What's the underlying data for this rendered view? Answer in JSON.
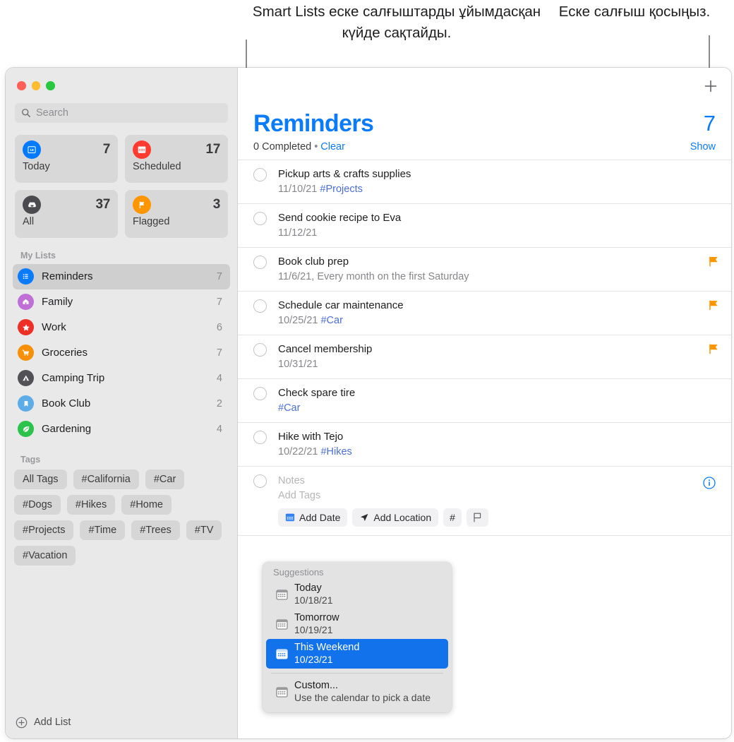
{
  "callouts": {
    "smart_lists": "Smart Lists еске салғыштарды ұйымдасқан күйде сақтайды.",
    "add_reminder": "Еске салғыш қосыңыз."
  },
  "sidebar": {
    "search": {
      "placeholder": "Search",
      "icon": "search-icon"
    },
    "smart_lists": [
      {
        "label": "Today",
        "count": "7",
        "icon": "calendar-day-icon",
        "color": "#007aff"
      },
      {
        "label": "Scheduled",
        "count": "17",
        "icon": "calendar-icon",
        "color": "#ff3b30"
      },
      {
        "label": "All",
        "count": "37",
        "icon": "tray-icon",
        "color": "#4a4a4f"
      },
      {
        "label": "Flagged",
        "count": "3",
        "icon": "flag-icon",
        "color": "#ff9500"
      }
    ],
    "my_lists_title": "My Lists",
    "my_lists": [
      {
        "label": "Reminders",
        "count": "7",
        "icon": "list-bullet-icon",
        "color": "#0a7bfb",
        "selected": true
      },
      {
        "label": "Family",
        "count": "7",
        "icon": "house-icon",
        "color": "#bf6fd6"
      },
      {
        "label": "Work",
        "count": "6",
        "icon": "star-icon",
        "color": "#ee2f26"
      },
      {
        "label": "Groceries",
        "count": "7",
        "icon": "cart-icon",
        "color": "#f79009"
      },
      {
        "label": "Camping Trip",
        "count": "4",
        "icon": "tent-icon",
        "color": "#515156"
      },
      {
        "label": "Book Club",
        "count": "2",
        "icon": "bookmark-icon",
        "color": "#5bace7"
      },
      {
        "label": "Gardening",
        "count": "4",
        "icon": "leaf-icon",
        "color": "#2cc34a"
      }
    ],
    "tags_title": "Tags",
    "tags": [
      "All Tags",
      "#California",
      "#Car",
      "#Dogs",
      "#Hikes",
      "#Home",
      "#Projects",
      "#Time",
      "#Trees",
      "#TV",
      "#Vacation"
    ],
    "add_list_label": "Add List"
  },
  "main": {
    "add_button_icon": "plus-icon",
    "title": "Reminders",
    "title_count": "7",
    "completed_text": "0 Completed",
    "separator": "•",
    "clear_label": "Clear",
    "show_label": "Show",
    "reminders": [
      {
        "title": "Pickup arts & crafts supplies",
        "date": "11/10/21",
        "tag": "#Projects",
        "flagged": false
      },
      {
        "title": "Send cookie recipe to Eva",
        "date": "11/12/21",
        "tag": "",
        "flagged": false
      },
      {
        "title": "Book club prep",
        "date": "11/6/21, Every month on the first Saturday",
        "tag": "",
        "flagged": true
      },
      {
        "title": "Schedule car maintenance",
        "date": "10/25/21",
        "tag": "#Car",
        "flagged": true
      },
      {
        "title": "Cancel membership",
        "date": "10/31/21",
        "tag": "",
        "flagged": true
      },
      {
        "title": "Check spare tire",
        "date": "",
        "tag": "#Car",
        "flagged": false
      },
      {
        "title": "Hike with Tejo",
        "date": "10/22/21",
        "tag": "#Hikes",
        "flagged": false
      }
    ],
    "editing": {
      "notes_placeholder": "Notes",
      "tags_placeholder": "Add Tags",
      "toolbar": {
        "add_date": "Add Date",
        "add_location": "Add Location",
        "tag_symbol": "#",
        "flag_icon": "flag-outline-icon"
      },
      "info_icon": "info-circle-icon"
    }
  },
  "suggestions": {
    "title": "Suggestions",
    "items": [
      {
        "name": "Today",
        "sub": "10/18/21",
        "selected": false
      },
      {
        "name": "Tomorrow",
        "sub": "10/19/21",
        "selected": false
      },
      {
        "name": "This Weekend",
        "sub": "10/23/21",
        "selected": true
      }
    ],
    "custom": {
      "name": "Custom...",
      "sub": "Use the calendar to pick a date"
    }
  },
  "colors": {
    "accent": "#0a7bfb",
    "flag": "#ff9500",
    "selection": "#1272ec",
    "hashtag": "#4b6ed3"
  }
}
